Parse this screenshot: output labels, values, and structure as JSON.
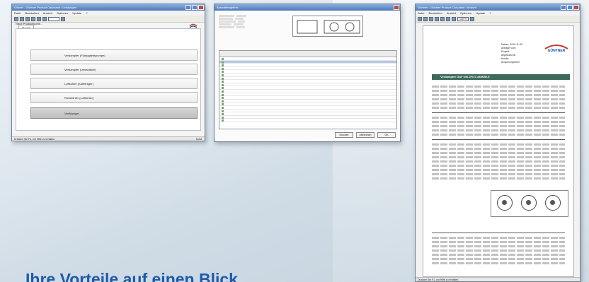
{
  "headline": "Ihre Vorteile auf einen Blick",
  "window1": {
    "title": "Gültner - Güntner Product Calculator / Leistungen",
    "menu": [
      "Datei",
      "Bearbeiten",
      "Ansicht",
      "Optionen",
      "Update",
      "?"
    ],
    "group_label": "Neue Produktsuche...",
    "tab": "Modell",
    "choices": [
      {
        "label": "Verdampfer (Flüssigkeitspumpe)",
        "active": false
      },
      {
        "label": "Verdampfer (Umlaufkühl)",
        "active": false
      },
      {
        "label": "Luftkühler (Kälteträger)",
        "active": false
      },
      {
        "label": "Rückkühler (Luftkühler)",
        "active": false
      },
      {
        "label": "Verflüssiger",
        "active": true
      }
    ],
    "status": "Drücken Sie F1, um Hilfe zu erhalten.",
    "status_right": "NUM"
  },
  "window2": {
    "title": "Auswahlergebnis",
    "buttons": [
      "Drucken",
      "Abbrechen",
      "OK"
    ]
  },
  "window3": {
    "title": "Güntner - Güntner Product Calculator / Ansicht",
    "menu": [
      "Datei",
      "Bearbeiten",
      "Ansicht",
      "Optionen",
      "Update",
      "?"
    ],
    "zoom": "125 %",
    "page_info": [
      "Datum: 2010-11-05",
      "Anfrage vom:",
      "Projekt:",
      "Angebots-Nr.:",
      "Kunde:",
      "Ansprechpartner:"
    ],
    "product_name": "Verdampfer    GAF 040.2F/37-ANW50.E",
    "brand": "GÜNTNER",
    "status": "Drücken Sie F1, um Hilfe zu erhalten."
  },
  "colors": {
    "accent": "#1d5aa8",
    "titlebar": "#4d79b8",
    "product_bar": "#3d6b5a"
  }
}
